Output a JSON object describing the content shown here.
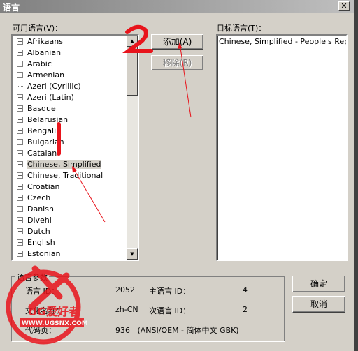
{
  "window": {
    "title": "语言",
    "close": "✕"
  },
  "available": {
    "label": "可用语言(V)：",
    "items": [
      "Afrikaans",
      "Albanian",
      "Arabic",
      "Armenian",
      "Azeri (Cyrillic)",
      "Azeri (Latin)",
      "Basque",
      "Belarusian",
      "Bengali",
      "Bulgarian",
      "Catalan",
      "Chinese, Simplified",
      "Chinese, Traditional",
      "Croatian",
      "Czech",
      "Danish",
      "Divehi",
      "Dutch",
      "English",
      "Estonian"
    ],
    "expandable": [
      true,
      true,
      true,
      true,
      false,
      true,
      true,
      true,
      true,
      true,
      true,
      true,
      true,
      true,
      true,
      true,
      true,
      true,
      true,
      true
    ],
    "selected": "Chinese, Simplified"
  },
  "buttons": {
    "add": "添加(A)",
    "remove": "移除(R)",
    "ok": "确定",
    "cancel": "取消"
  },
  "target": {
    "label": "目标语言(T)：",
    "items": [
      "Chinese, Simplified - People's Republic"
    ]
  },
  "params": {
    "title": "语言参数",
    "lang_id_label": "语言 ID：",
    "lang_id": "2052",
    "primary_label": "主语言 ID：",
    "primary": "4",
    "culture_label": "文化名称：",
    "culture": "zh-CN",
    "sub_label": "次语言 ID：",
    "sub": "2",
    "codepage_label": "代码页：",
    "codepage": "936   (ANSI/OEM - 简体中文 GBK)"
  },
  "annotations": {
    "step1": "1",
    "step2": "2",
    "color": "#e8141c"
  },
  "watermark": {
    "brand": "UG爱好者",
    "url": "WWW.UGSNX.COM"
  }
}
